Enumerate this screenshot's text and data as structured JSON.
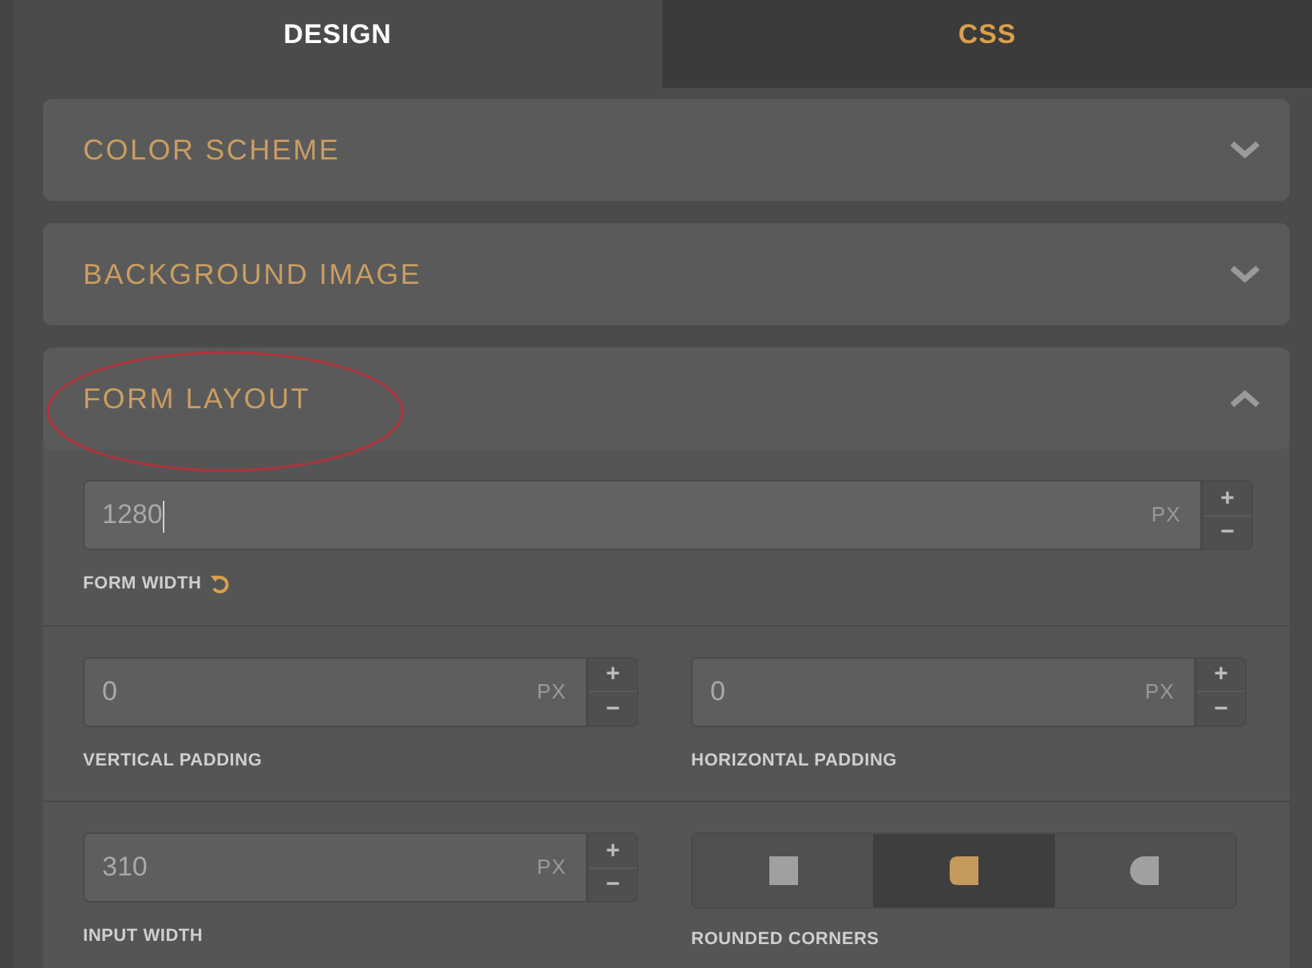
{
  "tabs": [
    {
      "label": "DESIGN",
      "selected": true
    },
    {
      "label": "CSS",
      "selected": false
    }
  ],
  "sections": [
    {
      "title": "COLOR SCHEME",
      "expanded": false,
      "circled": false
    },
    {
      "title": "BACKGROUND IMAGE",
      "expanded": false,
      "circled": false
    },
    {
      "title": "FORM LAYOUT",
      "expanded": true,
      "circled": true,
      "rows": [
        {
          "items": [
            {
              "kind": "number",
              "value": "1280",
              "unit": "PX",
              "label": "FORM WIDTH",
              "reset": true,
              "focused": true,
              "plus": "+",
              "minus": "−"
            }
          ]
        },
        {
          "items": [
            {
              "kind": "number",
              "value": "0",
              "unit": "PX",
              "label": "VERTICAL PADDING",
              "focused": false,
              "plus": "+",
              "minus": "−"
            },
            {
              "kind": "number",
              "value": "0",
              "unit": "PX",
              "label": "HORIZONTAL PADDING",
              "focused": false,
              "plus": "+",
              "minus": "−"
            }
          ]
        },
        {
          "items": [
            {
              "kind": "number",
              "value": "310",
              "unit": "PX",
              "label": "INPUT WIDTH",
              "focused": false,
              "plus": "+",
              "minus": "−"
            },
            {
              "kind": "corners",
              "label": "ROUNDED CORNERS",
              "options": [
                {
                  "kind": "square",
                  "selected": false
                },
                {
                  "kind": "rounded",
                  "selected": true
                },
                {
                  "kind": "half",
                  "selected": false
                }
              ]
            }
          ]
        }
      ]
    }
  ]
}
